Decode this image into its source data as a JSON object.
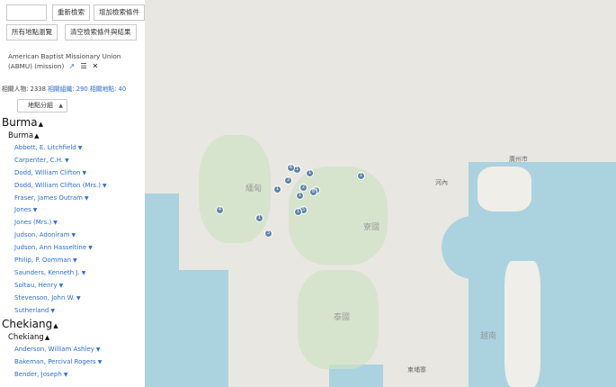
{
  "toolbar": {
    "search_input_value": "",
    "re_search_label": "重新檢索",
    "add_condition_label": "增加檢索條件",
    "all_places_label": "所有地點瀏覽",
    "clear_label": "清空檢索條件與結果"
  },
  "entity": {
    "name": "American Baptist Missionary Union (ABMU) (mission)"
  },
  "counts": {
    "persons_label": "相關人物: 2338",
    "orgs_label": "相關組織: 290",
    "places_label": "相關地點: 40"
  },
  "group_select": {
    "value": "地點分組"
  },
  "groups": [
    {
      "name": "Burma",
      "sub": "Burma",
      "items": [
        "Abbott, E. Litchfield",
        "Carpenter, C.H.",
        "Dodd, William Clifton",
        "Dodd, William Clifton (Mrs.)",
        "Fraser, James Outram",
        "Jones",
        "Jones (Mrs.)",
        "Judson, Adoniram",
        "Judson, Ann Hasseltine",
        "Philip, P. Oomman",
        "Saunders, Kenneth J.",
        "Soltau, Henry",
        "Stevenson, John W.",
        "Sutherland"
      ]
    },
    {
      "name": "Chekiang",
      "sub": "Chekiang",
      "items": [
        "Anderson, William Ashley",
        "Bakeman, Percival Rogers",
        "Bender, Joseph"
      ]
    }
  ],
  "map": {
    "labels": {
      "guangzhou": "廣州市",
      "hanoi": "河內",
      "laos": "寮國",
      "thailand": "泰國",
      "vietnam": "越南",
      "cambodia": "柬埔寨",
      "myanmar": "緬甸"
    },
    "markers": [
      "1",
      "1",
      "3",
      "1",
      "2",
      "1",
      "3",
      "5",
      "8",
      "1",
      "4",
      "1",
      "3",
      "1",
      "6"
    ]
  }
}
